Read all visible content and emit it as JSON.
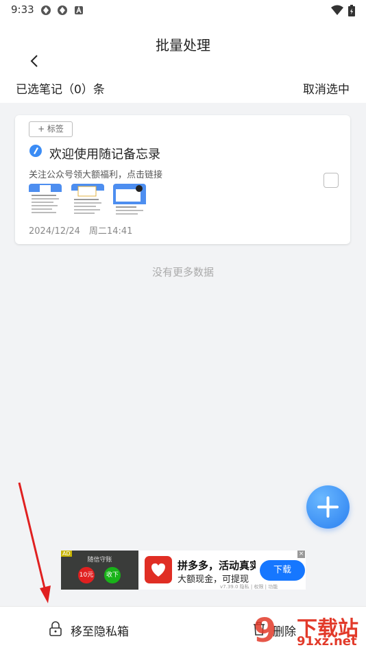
{
  "status_bar": {
    "time": "9:33"
  },
  "header": {
    "title": "批量处理"
  },
  "selection": {
    "count_text": "已选笔记（0）条",
    "cancel_label": "取消选中"
  },
  "note": {
    "tag_label": "+ 标签",
    "title": "欢迎使用随记备忘录",
    "subtitle": "关注公众号领大额福利，点击链接",
    "date": "2024/12/24　周二14:41",
    "checked": false
  },
  "list_footer": "没有更多数据",
  "ad": {
    "badge": "AD",
    "left_title": "随信守账",
    "red_button": "10元",
    "green_button": "收下",
    "title": "拼多多，活动真实",
    "subtitle": "大额现金，可提现",
    "small_text": "v7.39.0  隐私 | 权限 | 功能",
    "download_label": "下载",
    "close_label": "×"
  },
  "bottom": {
    "move_label": "移至隐私箱",
    "delete_label": "删除"
  },
  "watermark": {
    "text": "下载站",
    "url": "91xz.net"
  },
  "colors": {
    "accent": "#2a7ff0",
    "arrow": "#e02020",
    "background": "#f2f3f5"
  }
}
